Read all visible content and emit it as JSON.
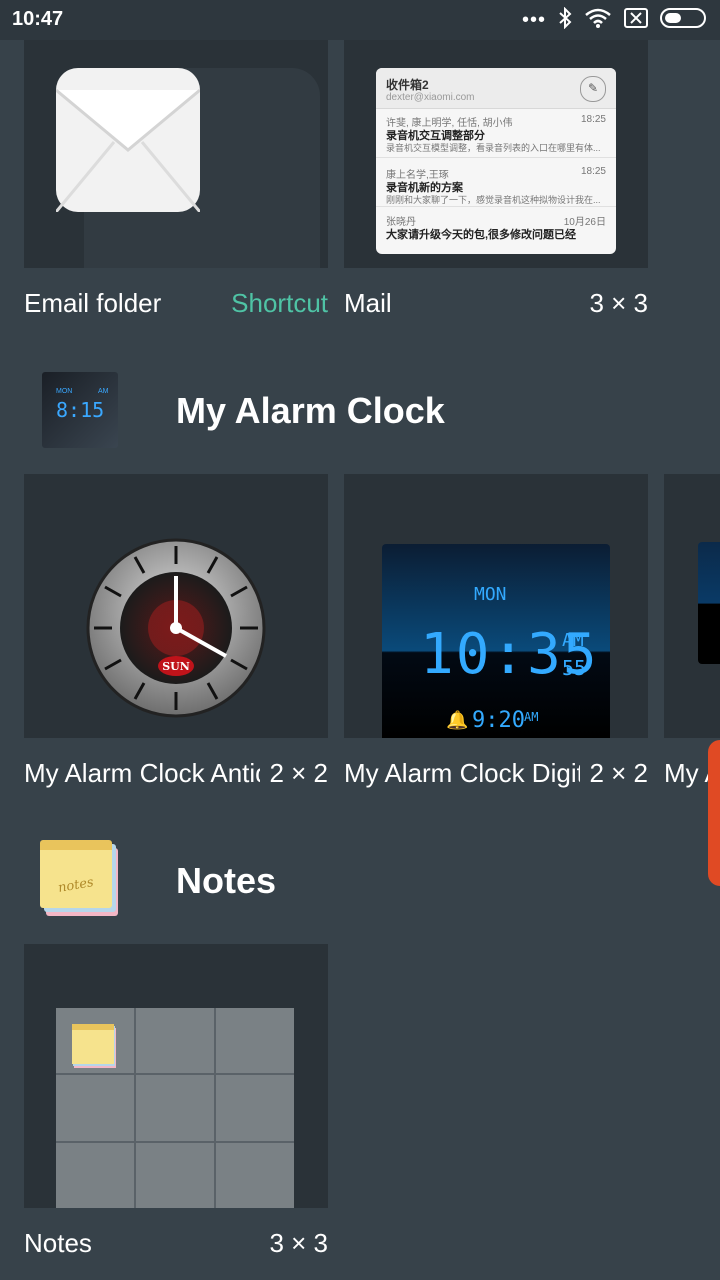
{
  "status": {
    "time": "10:47"
  },
  "colors": {
    "accent": "#4fc3a5",
    "background": "#37424a",
    "tile": "#2a3238",
    "scroll_indicator": "#e04a24"
  },
  "email_section": {
    "widgets": [
      {
        "name": "Email folder",
        "size": "Shortcut"
      },
      {
        "name": "Mail",
        "size": "3 × 3"
      }
    ],
    "mail_preview": {
      "folder": "收件箱2",
      "account": "dexter@xiaomi.com",
      "messages": [
        {
          "from": "许斐, 康上明学, 任恬, 胡小伟",
          "time": "18:25",
          "subject": "录音机交互调整部分",
          "snippet": "录音机交互模型调整，看录音列表的入口在哪里有体..."
        },
        {
          "from": "康上名学,王琢",
          "time": "18:25",
          "subject": "录音机新的方案",
          "snippet": "刚刚和大家聊了一下，感觉录音机这种拟物设计我在..."
        },
        {
          "from": "张晓丹",
          "time": "10月26日",
          "subject": "大家请升级今天的包,很多修改问题已经",
          "snippet": ""
        }
      ]
    }
  },
  "alarm_section": {
    "title": "My Alarm Clock",
    "widgets": [
      {
        "name": "My Alarm Clock Antiq..",
        "size": "2 × 2"
      },
      {
        "name": "My Alarm Clock Digital",
        "size": "2 × 2"
      },
      {
        "name": "My A",
        "size": ""
      }
    ],
    "digital_preview": {
      "day": "MON",
      "time": "10:35",
      "ampm": "AM",
      "seconds": "55",
      "alarm": "9:20",
      "alarm_ampm": "AM"
    },
    "antique_preview": {
      "day": "SUN"
    },
    "icon_preview": {
      "time": "8:15",
      "day": "MON",
      "ampm": "AM"
    }
  },
  "notes_section": {
    "title": "Notes",
    "widgets": [
      {
        "name": "Notes",
        "size": "3 × 3"
      }
    ],
    "icon_text": "notes"
  }
}
